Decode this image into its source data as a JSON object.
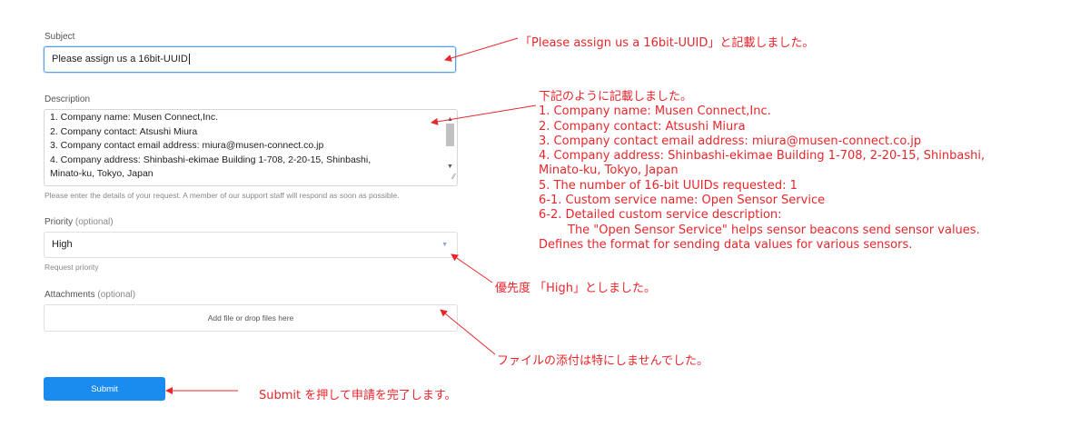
{
  "form": {
    "subject_label": "Subject",
    "subject_value": "Please assign us a 16bit-UUID",
    "description_label": "Description",
    "description_lines": [
      "1. Company name: Musen Connect,Inc.",
      "2. Company contact: Atsushi Miura",
      "3. Company contact email address:  miura@musen-connect.co.jp",
      "4. Company address:  Shinbashi-ekimae Building 1-708, 2-20-15, Shinbashi,",
      "Minato-ku, Tokyo, Japan"
    ],
    "description_hint": "Please enter the details of your request. A member of our support staff will respond as soon as possible.",
    "priority_label": "Priority",
    "priority_optional": "(optional)",
    "priority_value": "High",
    "priority_hint": "Request priority",
    "attachments_label": "Attachments",
    "attachments_optional": "(optional)",
    "attachments_placeholder": "Add file or drop files here",
    "submit_label": "Submit"
  },
  "annotations": {
    "subject_note": "「Please assign us a 16bit-UUID」と記載しました。",
    "description_intro": "下記のように記載しました。",
    "description_lines": [
      "1. Company name: Musen Connect,Inc.",
      "2. Company contact: Atsushi Miura",
      "3. Company contact email address:  miura@musen-connect.co.jp",
      "4. Company address:  Shinbashi-ekimae Building 1-708, 2-20-15, Shinbashi,",
      "Minato-ku, Tokyo, Japan",
      "5. The number of 16-bit UUIDs requested: 1",
      "6-1.  Custom service name: Open Sensor Service",
      "6-2. Detailed custom service description:"
    ],
    "description_indented": "The \"Open Sensor Service\" helps sensor beacons send sensor values.",
    "description_last": "Defines the format for sending data values for various sensors.",
    "priority_note": "優先度 「High」としました。",
    "attachments_note": "ファイルの添付は特にしませんでした。",
    "submit_note": "Submit を押して申請を完了します。"
  },
  "colors": {
    "annotation": "#e8262b",
    "submit_button": "#1a8cf0",
    "focus_border": "#5aa0e8"
  }
}
